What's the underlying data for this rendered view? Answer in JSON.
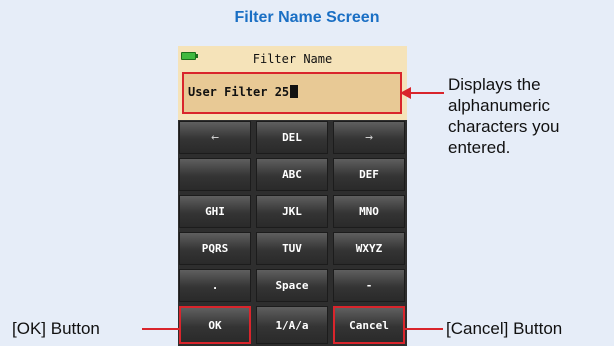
{
  "caption": "Filter Name Screen",
  "screen": {
    "title": "Filter Name",
    "display_value": "User Filter 25",
    "battery_icon": "battery-icon"
  },
  "keys": {
    "row1": [
      "←",
      "DEL",
      "→"
    ],
    "row2": [
      "",
      "ABC",
      "DEF"
    ],
    "row3": [
      "GHI",
      "JKL",
      "MNO"
    ],
    "row4": [
      "PQRS",
      "TUV",
      "WXYZ"
    ],
    "row5": [
      ".",
      "Space",
      "-"
    ],
    "row6": [
      "OK",
      "1/A/a",
      "Cancel"
    ]
  },
  "annotations": {
    "display_note": "Displays the alphanumeric characters you entered.",
    "ok_note": "[OK] Button",
    "cancel_note": "[Cancel] Button"
  },
  "colors": {
    "caption": "#1a6fc4",
    "highlight": "#d9252c",
    "panel": "#f5e3b9",
    "display": "#e8c995",
    "battery": "#3fb93f"
  }
}
